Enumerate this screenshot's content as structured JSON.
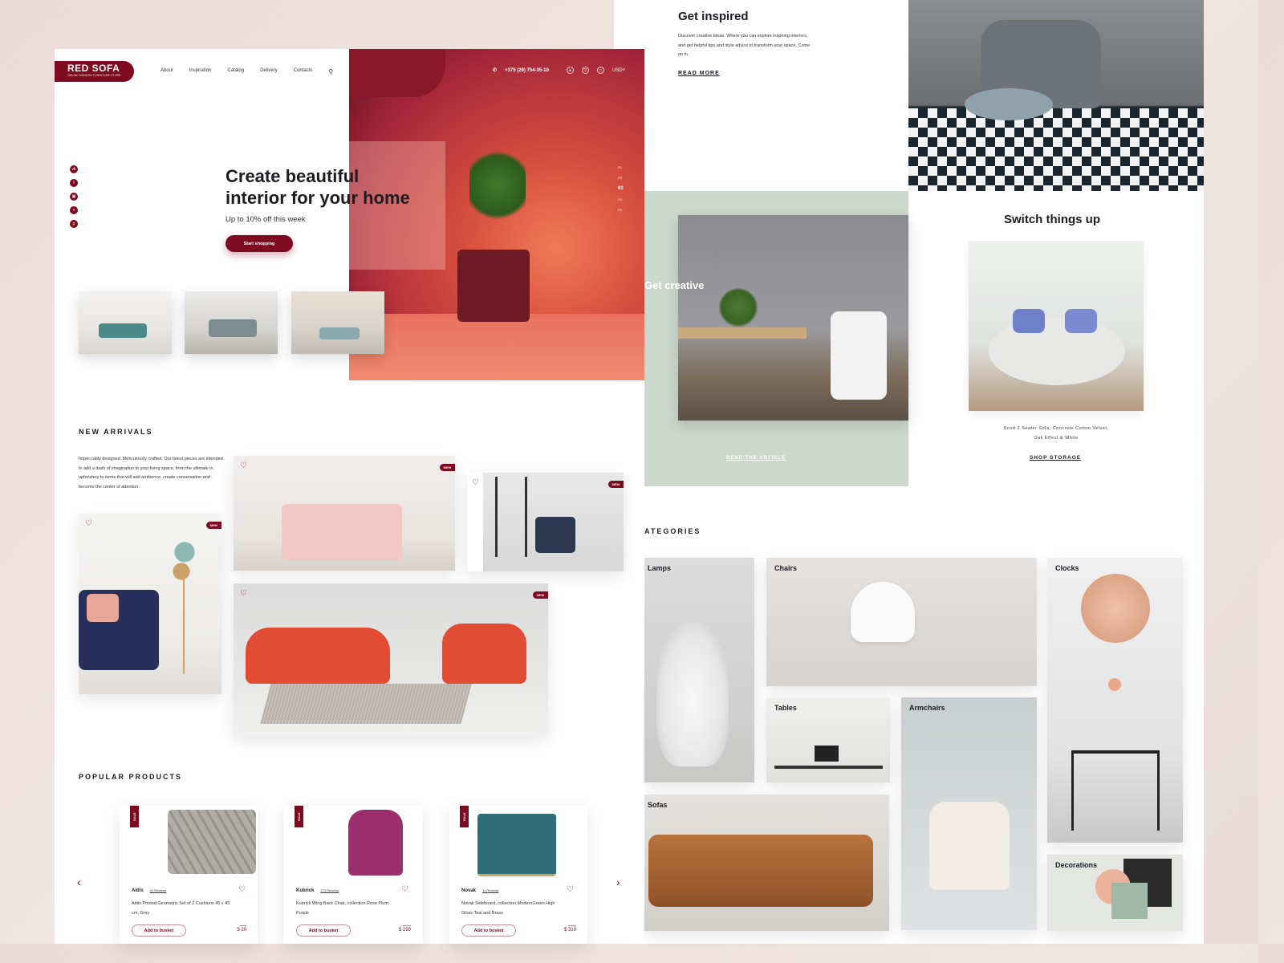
{
  "brand": {
    "name": "RED SOFA",
    "tagline": "ONLINE MODERN FURNITURE STORE"
  },
  "nav": {
    "items": [
      "About",
      "Inspiration",
      "Catalog",
      "Delivery",
      "Contacts"
    ]
  },
  "header": {
    "phone": "+375 (29) 754-35-16",
    "currency": "USD"
  },
  "hero": {
    "title_line1": "Create beautiful",
    "title_line2": "interior for your home",
    "subtitle": "Up to 10% off this week",
    "cta": "Start shopping",
    "slides": [
      "01",
      "02",
      "03",
      "04",
      "05"
    ],
    "active_slide": "03"
  },
  "social": [
    "vk",
    "facebook",
    "instagram",
    "vine",
    "pinterest"
  ],
  "new_arrivals": {
    "title": "NEW ARRIVALS",
    "description": "Impeccably designed. Meticulously crafted. Our latest pieces are intended to add a dash of imagination to your living space, from the ultimate in upholstery to items that will add ambience, create conversation and become the center of attention.",
    "badge": "NEW"
  },
  "popular": {
    "title": "POPULAR PRODUCTS",
    "sale_badge": "SALE",
    "products": [
      {
        "brand": "Aldis",
        "reviews": "52 Reviews",
        "name": "Aldis Printed Geometric Set of 2 Cushions 45 x 45 cm, Grey",
        "old_price": "$ 35",
        "price": "$ 20",
        "button": "Add to busket"
      },
      {
        "brand": "Kubrick",
        "reviews": "273 Reviews",
        "name": "Kubrick Wing Back Chair, collection Rose Plum Purple",
        "old_price": "$ 350",
        "price": "$ 299",
        "button": "Add to busket"
      },
      {
        "brand": "Novak",
        "reviews": "11 Reviews",
        "name": "Novak Sideboard, collection ModernGreen High Gloss Teal and Brass",
        "old_price": "$ 389",
        "price": "$ 319",
        "button": "Add to busket"
      }
    ]
  },
  "inspired": {
    "title": "Get inspired",
    "text": "Discover creative Ideas. Where you can explore inspiring interiors, and get helpful tips and style advice to transform your space. Come on in.",
    "link": "READ MORE"
  },
  "creative": {
    "title": "Get creative",
    "link": "READ THE ARTICLE"
  },
  "switch": {
    "title": "Switch things up",
    "caption_line1": "Scott 2 Seater Sofa, Concrete Cotton Velvet,",
    "caption_line2": "Oak Effect & White",
    "link": "SHOP STORAGE"
  },
  "categories": {
    "title": "ATEGORIES",
    "items": [
      "Lamps",
      "Chairs",
      "Clocks",
      "Tables",
      "Armchairs",
      "Sofas",
      "Decorations"
    ]
  }
}
